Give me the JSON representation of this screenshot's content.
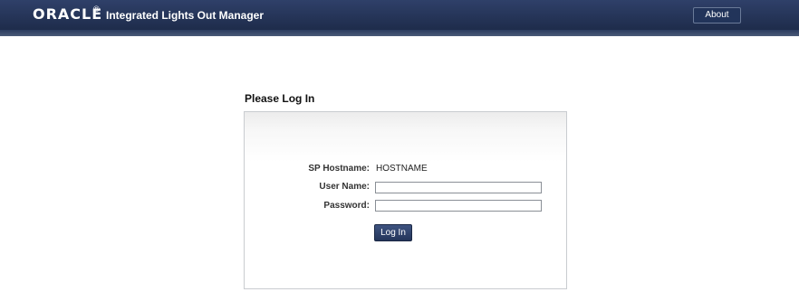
{
  "header": {
    "logo": "ORACLE",
    "logo_mark": "®",
    "app_title": "Integrated Lights Out Manager",
    "about_label": "About"
  },
  "login": {
    "heading": "Please Log In",
    "hostname_label": "SP Hostname:",
    "hostname_value": "HOSTNAME",
    "username_label": "User Name:",
    "username_value": "",
    "password_label": "Password:",
    "password_value": "",
    "submit_label": "Log In"
  },
  "colors": {
    "masthead": "#1e2c4b",
    "button": "#2e416a",
    "panel_border": "#c9ccd0"
  }
}
